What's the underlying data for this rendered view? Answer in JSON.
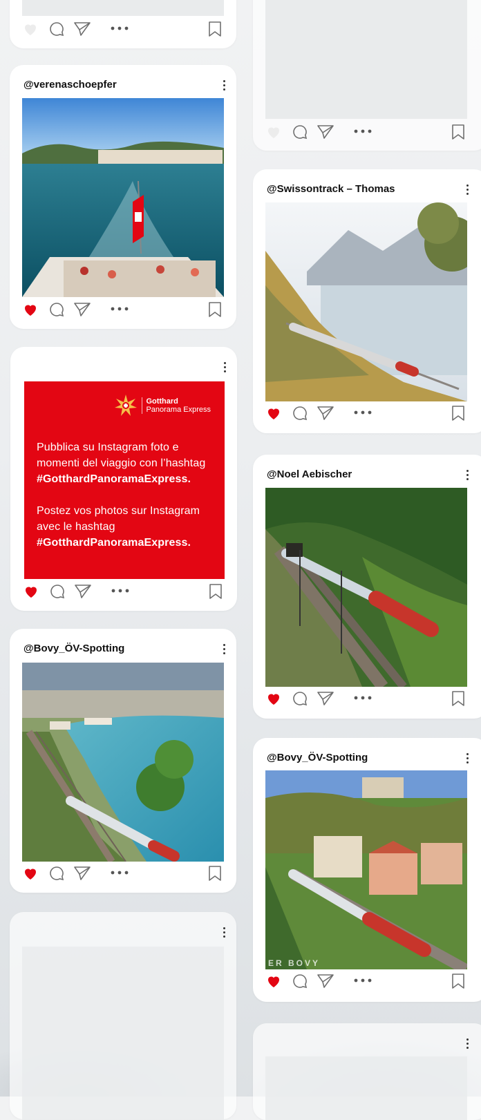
{
  "posts": [
    {
      "handle": ""
    },
    {
      "handle": "@verenaschoepfer"
    },
    {
      "handle": "@Swissontrack – Thomas"
    },
    {
      "handle": "@Noel Aebischer"
    },
    {
      "handle": "@Bovy_ÖV-Spotting"
    },
    {
      "handle": "@Bovy_ÖV-Spotting",
      "watermark": "ER BOVY"
    }
  ],
  "promo": {
    "logo_line1": "Gotthard",
    "logo_line2": "Panorama Express",
    "it_text": "Pubblica su Instagram foto e momenti del viaggio con l’hashtag",
    "it_hashtag": "#GotthardPanoramaExpress.",
    "fr_text": "Postez vos photos sur Instagram avec le hashtag",
    "fr_hashtag": "#GotthardPanoramaExpress."
  },
  "colors": {
    "like_active": "#e30613",
    "promo_bg": "#e30613",
    "icon": "#6f6f6f"
  },
  "icons": [
    "heart-icon",
    "comment-icon",
    "send-icon",
    "more-icon",
    "bookmark-icon",
    "kebab-icon"
  ]
}
